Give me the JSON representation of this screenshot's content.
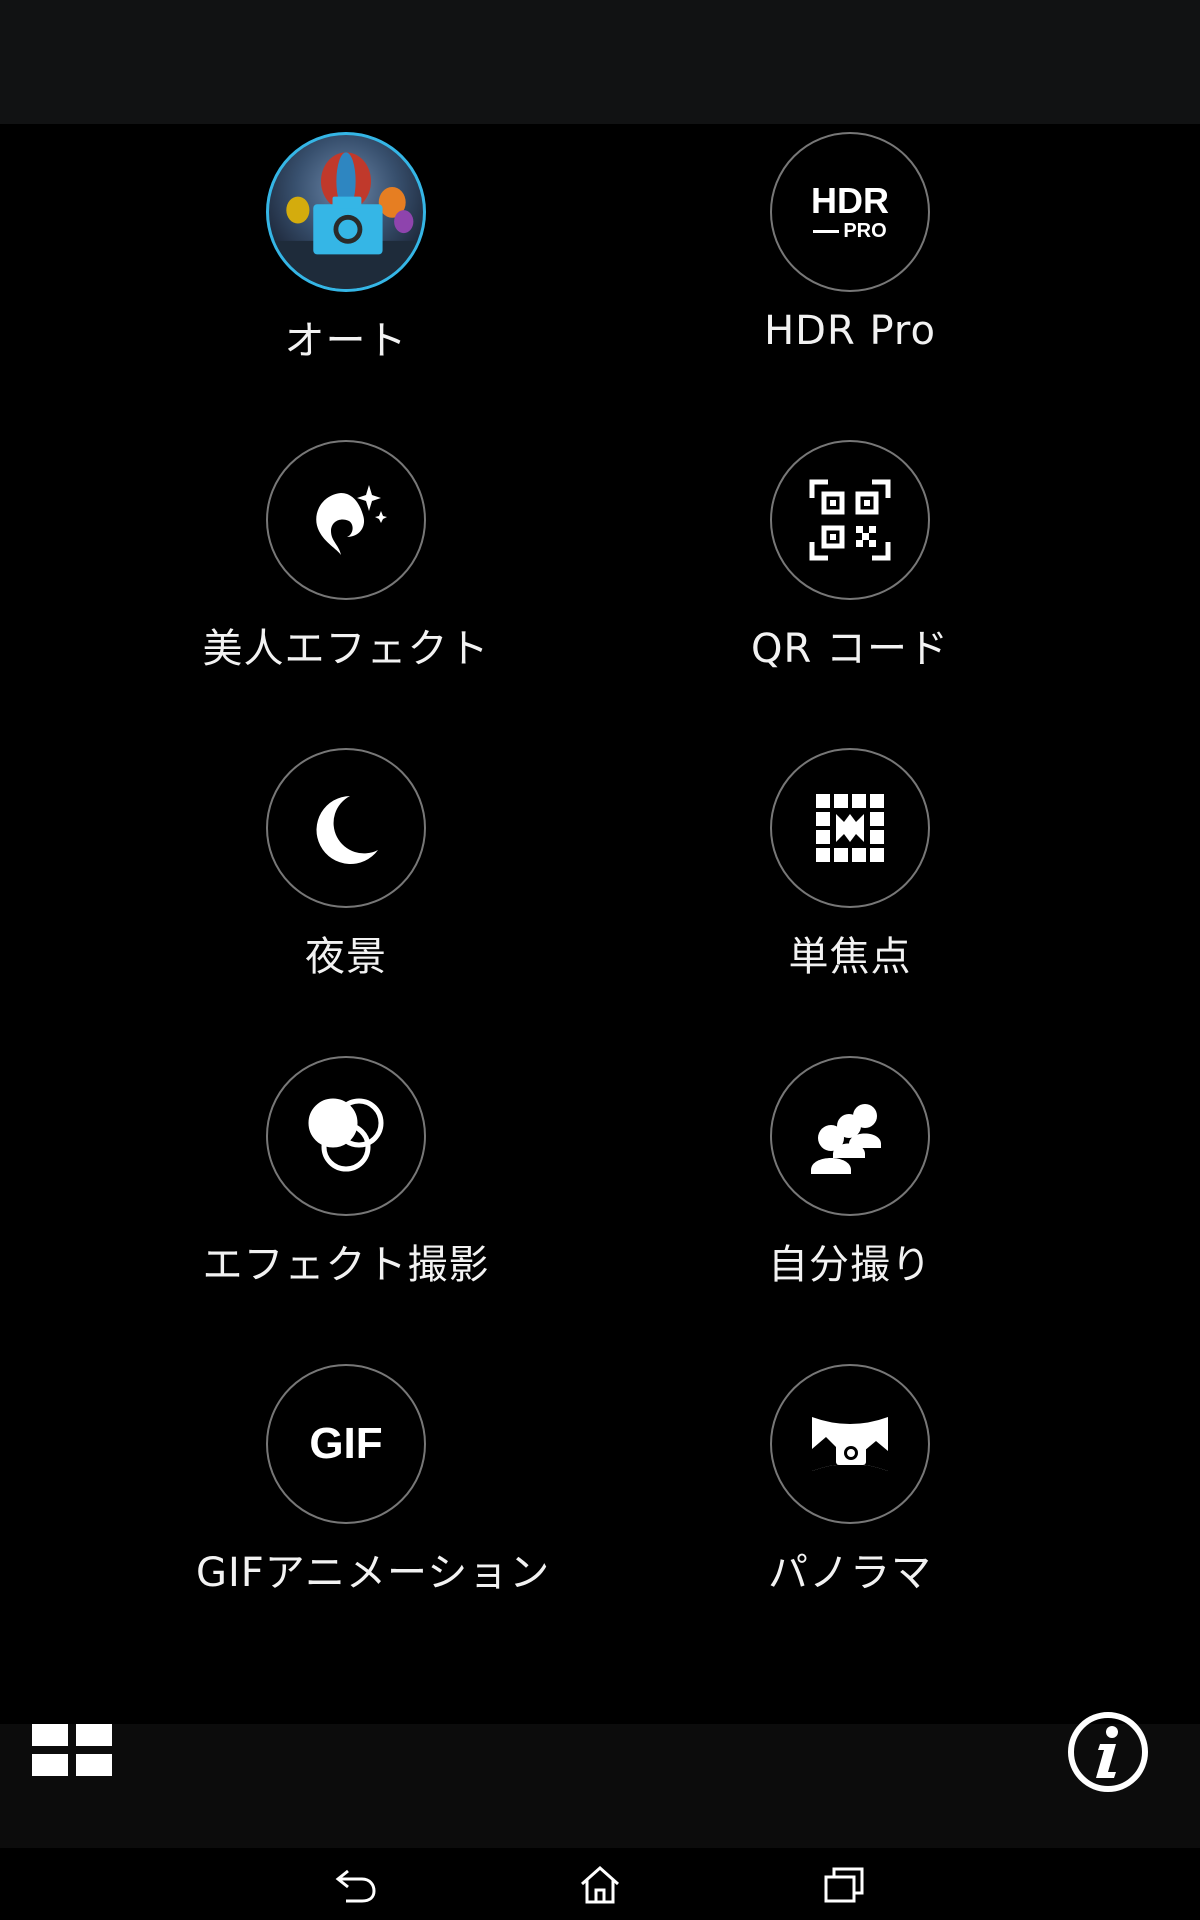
{
  "modes": [
    {
      "label": "オート",
      "icon": "auto-camera-icon",
      "selected": true
    },
    {
      "label": "HDR Pro",
      "icon": "hdr-pro-icon",
      "selected": false
    },
    {
      "label": "美人エフェクト",
      "icon": "beauty-effect-icon",
      "selected": false
    },
    {
      "label": "QR コード",
      "icon": "qr-code-icon",
      "selected": false
    },
    {
      "label": "夜景",
      "icon": "night-moon-icon",
      "selected": false
    },
    {
      "label": "単焦点",
      "icon": "single-focus-icon",
      "selected": false
    },
    {
      "label": "エフェクト撮影",
      "icon": "effect-circles-icon",
      "selected": false
    },
    {
      "label": "自分撮り",
      "icon": "selfie-people-icon",
      "selected": false
    },
    {
      "label": "GIFアニメーション",
      "icon": "gif-icon",
      "selected": false
    },
    {
      "label": "パノラマ",
      "icon": "panorama-icon",
      "selected": false
    }
  ],
  "icon_text": {
    "hdr_top": "HDR",
    "hdr_bottom": "PRO",
    "gif": "GIF"
  },
  "colors": {
    "accent": "#35b6e6",
    "background": "#000000",
    "status_bar": "#111213"
  }
}
